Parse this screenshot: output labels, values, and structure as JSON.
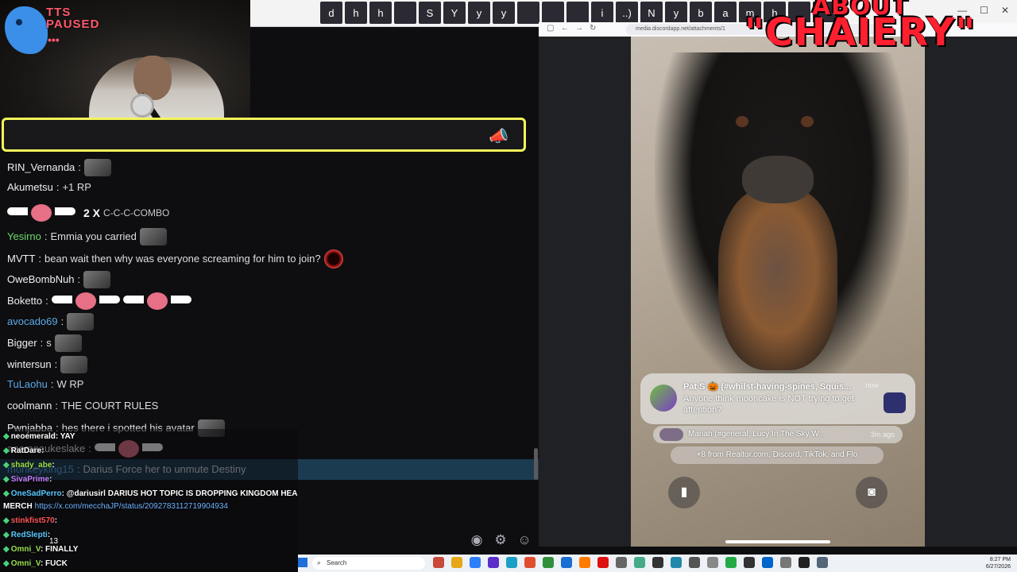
{
  "webcam": {
    "tts_status": "TTS\nPAUSED",
    "tts_dots": "•••"
  },
  "top_strip": {
    "emote_bar": [
      "d",
      "h",
      "h",
      "",
      "S",
      "Y",
      "y",
      "y",
      "",
      "",
      "",
      "i",
      "..)",
      "N",
      "y",
      "b",
      "a",
      "m",
      "h",
      "",
      ""
    ]
  },
  "title_overlay": {
    "line1": "ABOUT",
    "line2": "\"CHAIERY\""
  },
  "browser": {
    "address": "media.discordapp.net/attachments/1"
  },
  "chat": {
    "messages": [
      {
        "user": "RIN_Vernanda",
        "color": "#efeff1",
        "text": "",
        "emotes": [
          "emote"
        ]
      },
      {
        "user": "Akumetsu",
        "color": "#efeff1",
        "text": "+1 RP"
      },
      {
        "combo": true,
        "count": "2 X",
        "label": "C-C-C-COMBO"
      },
      {
        "user": "Yesirno",
        "color": "#6bd96b",
        "text": "Emmia you carried"
      },
      {
        "user": "MVTT",
        "color": "#efeff1",
        "text": "bean wait then why was everyone screaming for him to join?"
      },
      {
        "user": "OweBombNuh",
        "color": "#efeff1",
        "text": ""
      },
      {
        "user": "Boketto",
        "color": "#efeff1",
        "text": ""
      },
      {
        "user": "avocado69",
        "color": "#5aa9e6",
        "text": ""
      },
      {
        "user": "Bigger",
        "color": "#efeff1",
        "text": "s"
      },
      {
        "user": "wintersun",
        "color": "#efeff1",
        "text": ""
      },
      {
        "user": "TuLaohu",
        "color": "#5aa9e6",
        "text": "W RP"
      },
      {
        "user": "coolmann",
        "color": "#efeff1",
        "text": "THE COURT RULES"
      },
      {
        "user": "Pwnjabba",
        "color": "#efeff1",
        "text": "hes there i spotted his avatar"
      },
      {
        "user": "anemeaukeslake",
        "color": "#efeff1",
        "text": ""
      },
      {
        "user": "monkeyking15",
        "color": "#5aa9e6",
        "text": "Darius Force her to unmute Destiny"
      }
    ]
  },
  "overlay_chat": {
    "lines": [
      {
        "user": "neoemerald",
        "text": ": YAY",
        "color": "#ffffff"
      },
      {
        "user": "RatDare",
        "text": ":",
        "color": "#ffffff"
      },
      {
        "user": "shady_abe",
        "text": ":",
        "color": "#9be04d"
      },
      {
        "user": "SivaPrime",
        "text": ":",
        "color": "#c580ff"
      },
      {
        "user": "OneSadPerro",
        "text": ": @dariusirl DARIUS HOT TOPIC IS DROPPING KINGDOM HEARTS",
        "color": "#59c9ff"
      },
      {
        "user": "",
        "text": "MERCH",
        "link": "https://x.com/mecchaJP/status/2092783112719904934",
        "color": "#ffffff"
      },
      {
        "user": "stinkfist570",
        "text": ":",
        "color": "#ff5555"
      },
      {
        "user": "RedSlepti",
        "text": ":",
        "color": "#59c9ff"
      },
      {
        "user": "Omni_V",
        "text": ": FINALLY",
        "color": "#9be04d"
      },
      {
        "user": "Omni_V",
        "text": ": FUCK",
        "color": "#9be04d"
      }
    ],
    "counter": "13"
  },
  "notifications": {
    "main": {
      "title": "Pat S 🎃 (#whilst-having-spines, Squis...",
      "time": "now",
      "body": "Anyone think mooncake is NOT trying to get attention?"
    },
    "second": {
      "text": "Mariah (#general, Lucy In The Sky W...",
      "time": "3m ago"
    },
    "more": "+8 from Realtor.com, Discord, TikTok, and Flo"
  },
  "taskbar": {
    "search_placeholder": "Search",
    "time": "8:27 PM",
    "date": "6/27/2026"
  },
  "colors": {
    "accent_highlight": "#f3f55a",
    "chat_bg": "#0e0e10",
    "title_red": "#ff1f2f"
  }
}
